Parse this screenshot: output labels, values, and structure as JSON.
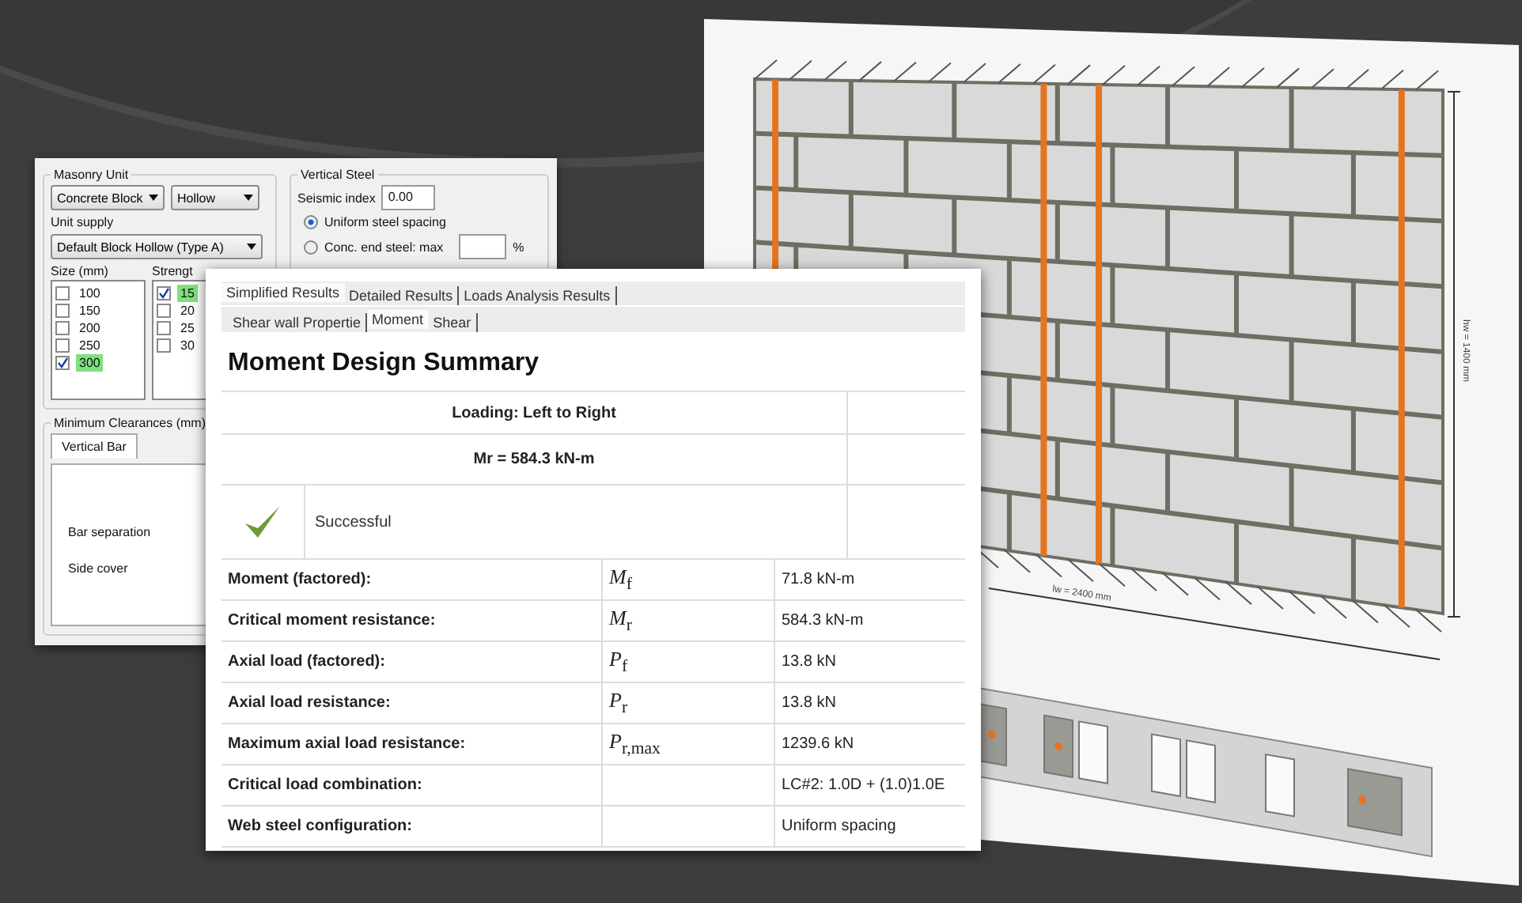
{
  "masonry_unit": {
    "title": "Masonry Unit",
    "unit_type": "Concrete Block",
    "core": "Hollow",
    "unit_supply_label": "Unit supply",
    "unit_supply": "Default Block Hollow (Type A)",
    "size_label": "Size (mm)",
    "strength_label": "Strengt",
    "sizes": [
      {
        "label": "100",
        "checked": false
      },
      {
        "label": "150",
        "checked": false
      },
      {
        "label": "200",
        "checked": false
      },
      {
        "label": "250",
        "checked": false
      },
      {
        "label": "300",
        "checked": true
      }
    ],
    "strengths": [
      {
        "label": "15",
        "checked": true
      },
      {
        "label": "20",
        "checked": false
      },
      {
        "label": "25",
        "checked": false
      },
      {
        "label": "30",
        "checked": false
      }
    ]
  },
  "vertical_steel": {
    "title": "Vertical Steel",
    "seismic_label": "Seismic index",
    "seismic_value": "0.00",
    "percent": "%",
    "options": [
      {
        "label": "Uniform steel spacing",
        "selected": true
      },
      {
        "label": "Conc. end steel: max",
        "selected": false
      }
    ]
  },
  "min_clearances": {
    "title": "Minimum Clearances (mm)",
    "tabs": [
      {
        "label": "Vertical Bar",
        "selected": true
      }
    ],
    "fields": [
      "Bar separation",
      "Side cover"
    ]
  },
  "results": {
    "tabs": [
      {
        "label": "Simplified Results",
        "selected": true
      },
      {
        "label": "Detailed Results",
        "selected": false
      },
      {
        "label": "Loads Analysis Results",
        "selected": false
      }
    ],
    "subtabs": [
      {
        "label": "Shear wall Propertie",
        "selected": false
      },
      {
        "label": "Moment",
        "selected": true
      },
      {
        "label": "Shear",
        "selected": false
      }
    ],
    "title": "Moment Design Summary",
    "loading": "Loading: Left to Right",
    "mr": "Mr = 584.3 kN-m",
    "status": "Successful",
    "passed": true,
    "rows": [
      {
        "label": "Moment (factored):",
        "symbol": "*M*$_{f}$",
        "value": "71.8 kN-m"
      },
      {
        "label": "Critical moment resistance:",
        "symbol": "*M*$_{r}$",
        "value": "584.3 kN-m"
      },
      {
        "label": "Axial load (factored):",
        "symbol": "*P*$_{f}$",
        "value": "13.8 kN"
      },
      {
        "label": "Axial load resistance:",
        "symbol": "*P*$_{r}$",
        "value": "13.8 kN"
      },
      {
        "label": "Maximum axial load resistance:",
        "symbol": "*P*$_{r,max}$",
        "value": "1239.6 kN"
      },
      {
        "label": "Critical load combination:",
        "symbol": "",
        "value": "LC#2: 1.0D + (1.0)1.0E"
      },
      {
        "label": "Web steel configuration:",
        "symbol": "",
        "value": "Uniform spacing"
      }
    ]
  },
  "wall": {
    "width_label": "lw = 2400 mm",
    "height_label": "hw = 1400 mm"
  }
}
